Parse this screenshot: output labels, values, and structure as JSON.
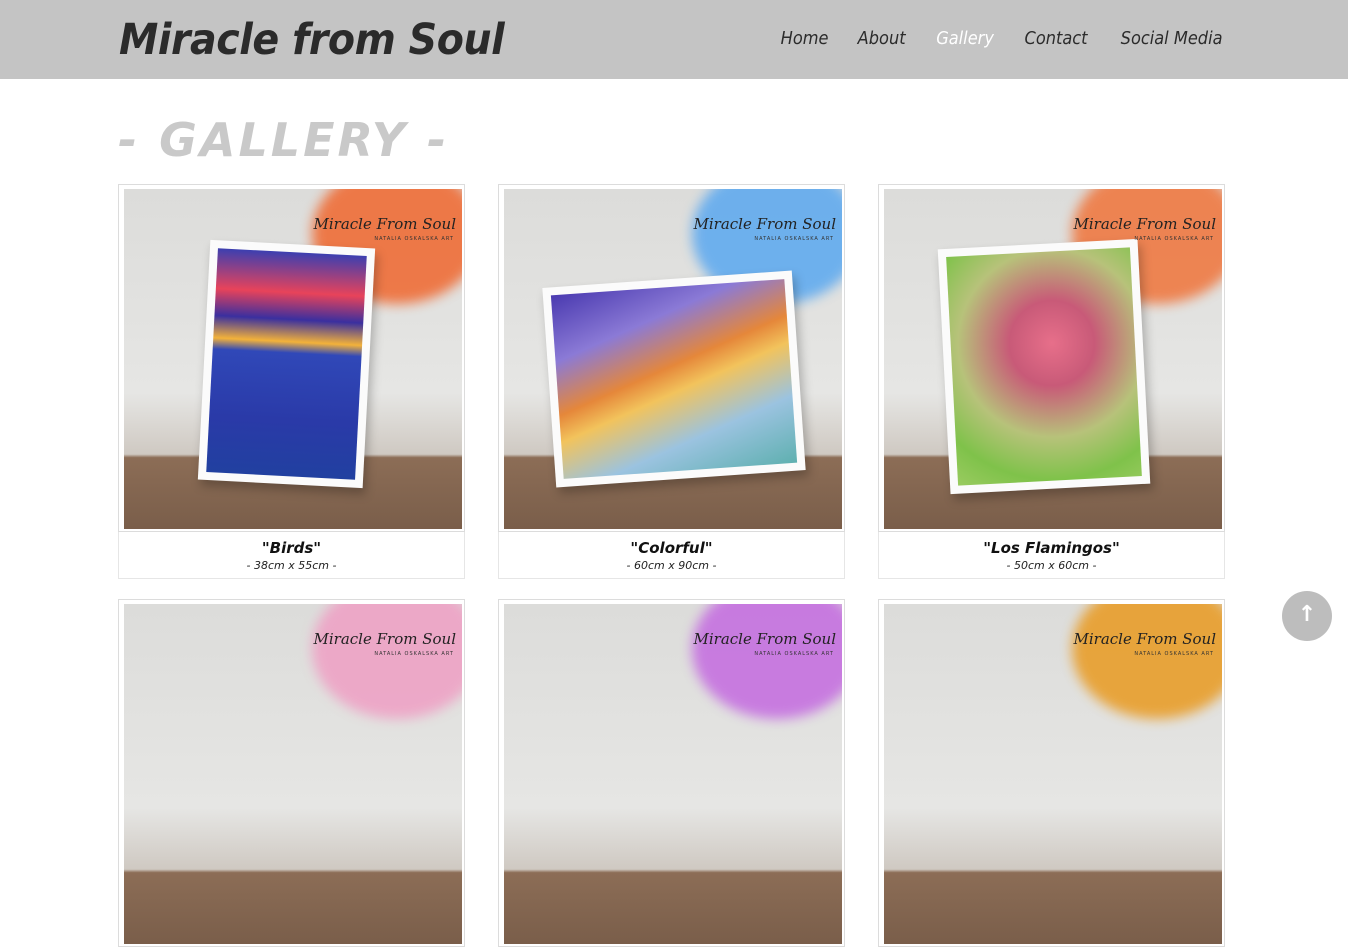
{
  "brand": "Miracle from Soul",
  "nav": [
    {
      "label": "Home",
      "active": false
    },
    {
      "label": "About",
      "active": false
    },
    {
      "label": "Gallery",
      "active": true
    },
    {
      "label": "Contact",
      "active": false
    },
    {
      "label": "Social Media",
      "active": false
    }
  ],
  "heading": "- GALLERY -",
  "watermark": {
    "text": "Miracle From Soul",
    "sub": "NATALIA OSKALSKA ART"
  },
  "gallery": [
    {
      "title": "\"Birds\"",
      "size": "- 38cm x 55cm -"
    },
    {
      "title": "\"Colorful\"",
      "size": "- 60cm x 90cm -"
    },
    {
      "title": "\"Los Flamingos\"",
      "size": "- 50cm x 60cm -"
    },
    {
      "title": "",
      "size": ""
    },
    {
      "title": "",
      "size": ""
    },
    {
      "title": "",
      "size": ""
    }
  ],
  "colors": {
    "splash": [
      "#f0672e",
      "#5aa8f0",
      "#f0743a",
      "#ef9fc4",
      "#c46ae0",
      "#e99a20"
    ]
  },
  "scroll_top_icon": "arrow-up-icon"
}
